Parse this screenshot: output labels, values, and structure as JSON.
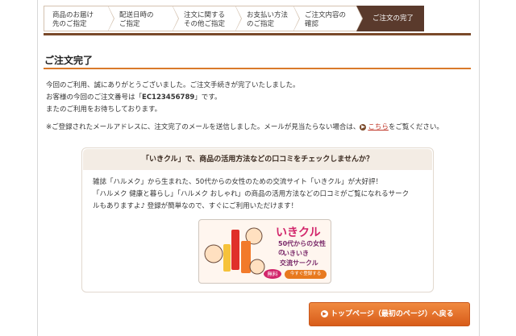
{
  "steps": [
    {
      "label": "商品のお届け\n先のご指定"
    },
    {
      "label": "配送日時の\nご指定"
    },
    {
      "label": "注文に関する\nその他ご指定"
    },
    {
      "label": "お支払い方法\nのご指定"
    },
    {
      "label": "ご注文内容の\n確認"
    },
    {
      "label": "ご注文の完了"
    }
  ],
  "page_title": "ご注文完了",
  "message": {
    "line1": "今回のご利用、誠にありがとうございました。ご注文手続きが完了いたしました。",
    "line2_prefix": "お客様の今回のご注文番号は「",
    "order_number": "EC123456789",
    "line2_suffix": "」です。",
    "line3": "またのご利用をお待ちしております。"
  },
  "mail_note": {
    "prefix": "※ご登録されたメールアドレスに、注文完了のメールを送信しました。メールが見当たらない場合は、",
    "link": "こちら",
    "suffix": "をご覧ください。"
  },
  "promo": {
    "heading": "「いきクル」で、商品の活用方法などの口コミをチェックしませんか？",
    "text1": "雑誌「ハルメク」から生まれた、50代からの女性のための交流サイト「いきクル」が大好評！",
    "text2": "「ハルメク 健康と暮らし」「ハルメク おしゃれ」の商品の活用方法などの口コミがご覧になれるサーク",
    "text3": "ルもありますよ♪ 登録が簡単なので、すぐにご利用いただけます！",
    "banner": {
      "logo": "いきクル",
      "sub1": "50代からの女性の",
      "sub2": "いきいき",
      "sub3": "交流サークル",
      "free": "無料",
      "register": "今すぐ登録する"
    }
  },
  "top_button": "トップページ（最初のページ）へ戻る",
  "colors": {
    "accent": "#d97a2a",
    "brown": "#5a3a2c",
    "link": "#c0392b"
  }
}
